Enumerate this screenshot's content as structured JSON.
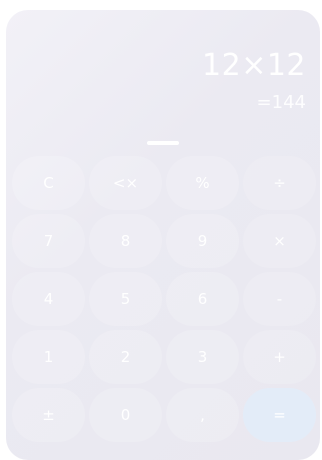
{
  "display": {
    "expression": "12×12",
    "result": "=144"
  },
  "keypad": {
    "rows": [
      [
        "C",
        "<×",
        "%",
        "÷"
      ],
      [
        "7",
        "8",
        "9",
        "×"
      ],
      [
        "4",
        "5",
        "6",
        "-"
      ],
      [
        "1",
        "2",
        "3",
        "+"
      ],
      [
        "±",
        "0",
        ",",
        "="
      ]
    ]
  },
  "colors": {
    "panel": "#ECEBF2",
    "equals_key": "#E3ECF8",
    "text": "#FFFFFF"
  }
}
